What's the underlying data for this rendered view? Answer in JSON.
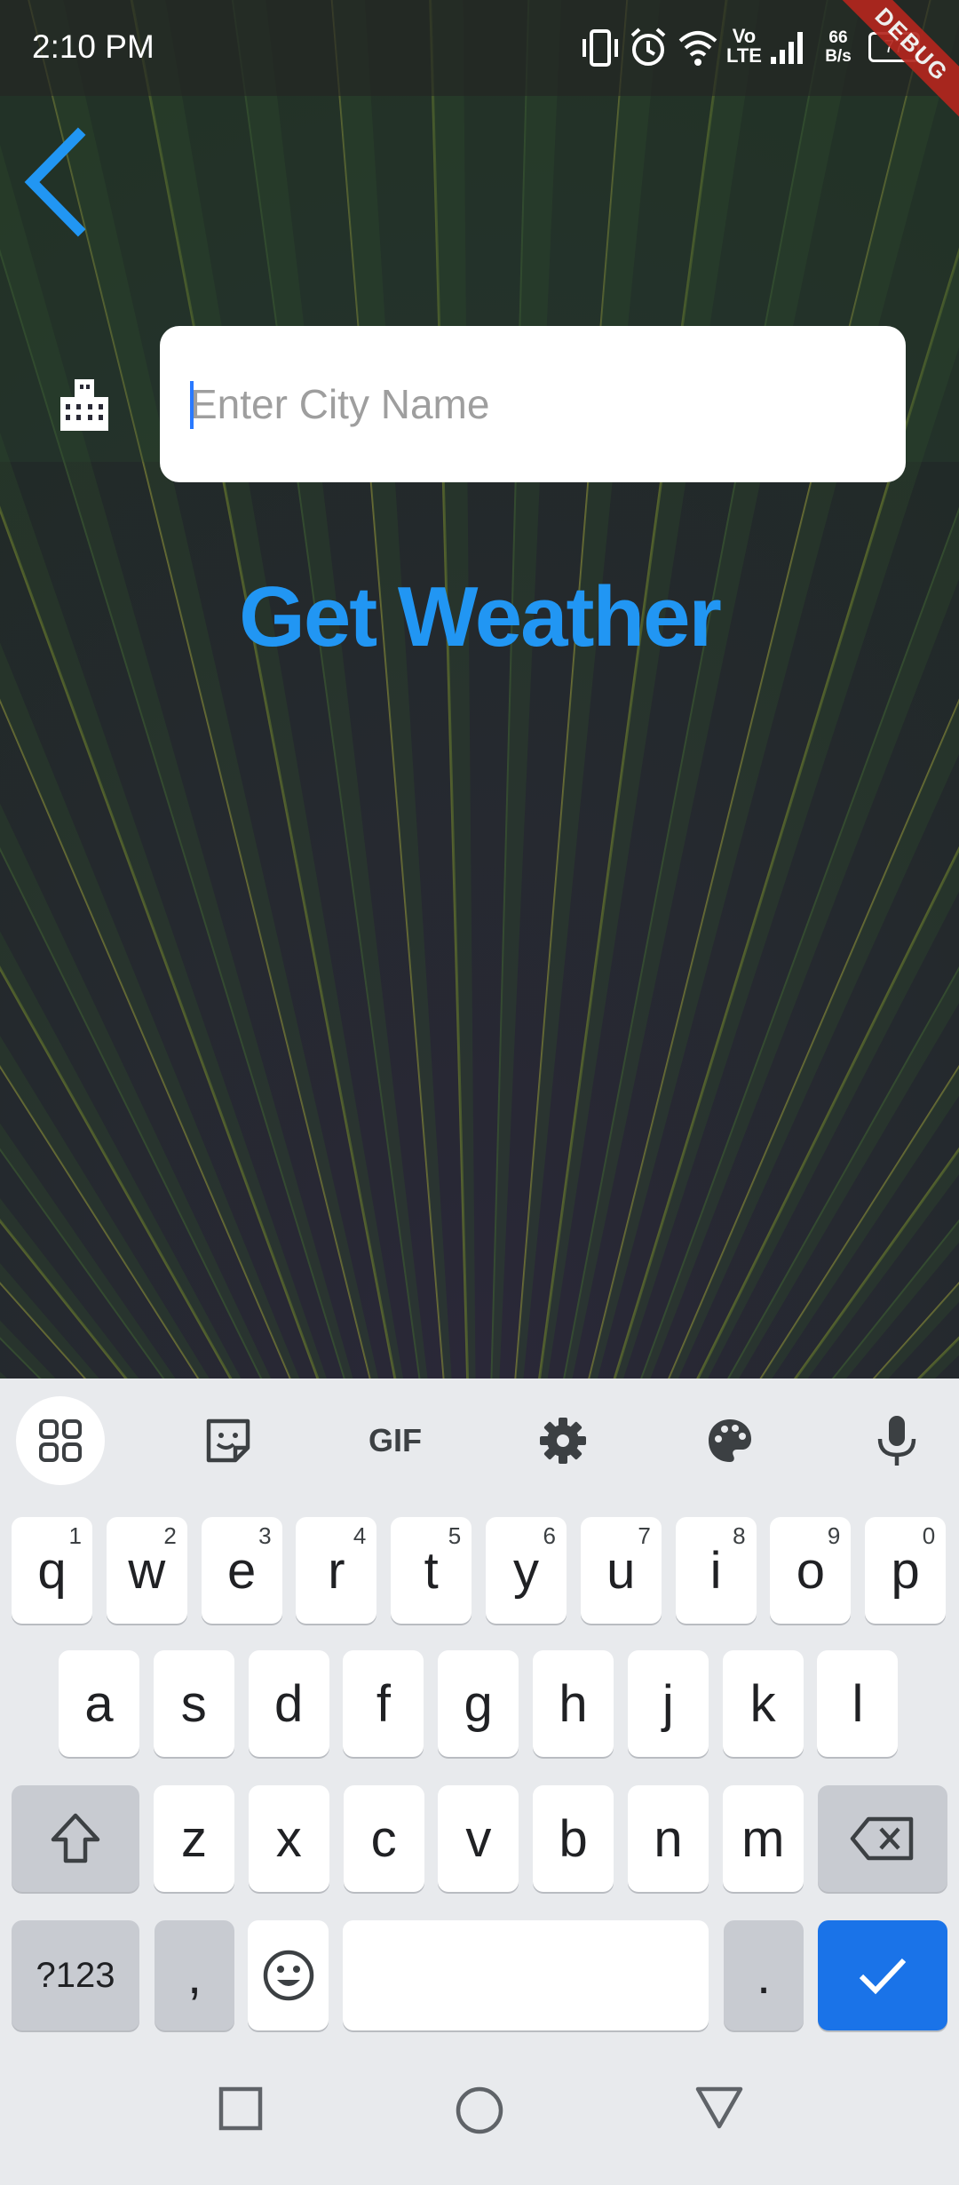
{
  "status_bar": {
    "time": "2:10 PM",
    "net_speed_top": "66",
    "net_speed_bottom": "B/s",
    "network_label_top": "Vo",
    "network_label_bottom": "LTE",
    "battery_level": "77",
    "debug_label": "DEBUG"
  },
  "app": {
    "city_input": {
      "placeholder": "Enter City Name",
      "value": ""
    },
    "get_weather_label": "Get Weather",
    "accent_color": "#2196f3"
  },
  "keyboard": {
    "toolbar": [
      "apps-icon",
      "sticker-icon",
      "gif-icon",
      "settings-icon",
      "palette-icon",
      "mic-icon"
    ],
    "gif_label": "GIF",
    "row1": [
      {
        "label": "q",
        "hint": "1"
      },
      {
        "label": "w",
        "hint": "2"
      },
      {
        "label": "e",
        "hint": "3"
      },
      {
        "label": "r",
        "hint": "4"
      },
      {
        "label": "t",
        "hint": "5"
      },
      {
        "label": "y",
        "hint": "6"
      },
      {
        "label": "u",
        "hint": "7"
      },
      {
        "label": "i",
        "hint": "8"
      },
      {
        "label": "o",
        "hint": "9"
      },
      {
        "label": "p",
        "hint": "0"
      }
    ],
    "row2": [
      "a",
      "s",
      "d",
      "f",
      "g",
      "h",
      "j",
      "k",
      "l"
    ],
    "row3": [
      "z",
      "x",
      "c",
      "v",
      "b",
      "n",
      "m"
    ],
    "symbols_label": "?123",
    "comma_label": ",",
    "period_label": "."
  },
  "nav_bar": {
    "buttons": [
      "recents-icon",
      "home-icon",
      "back-icon"
    ]
  }
}
